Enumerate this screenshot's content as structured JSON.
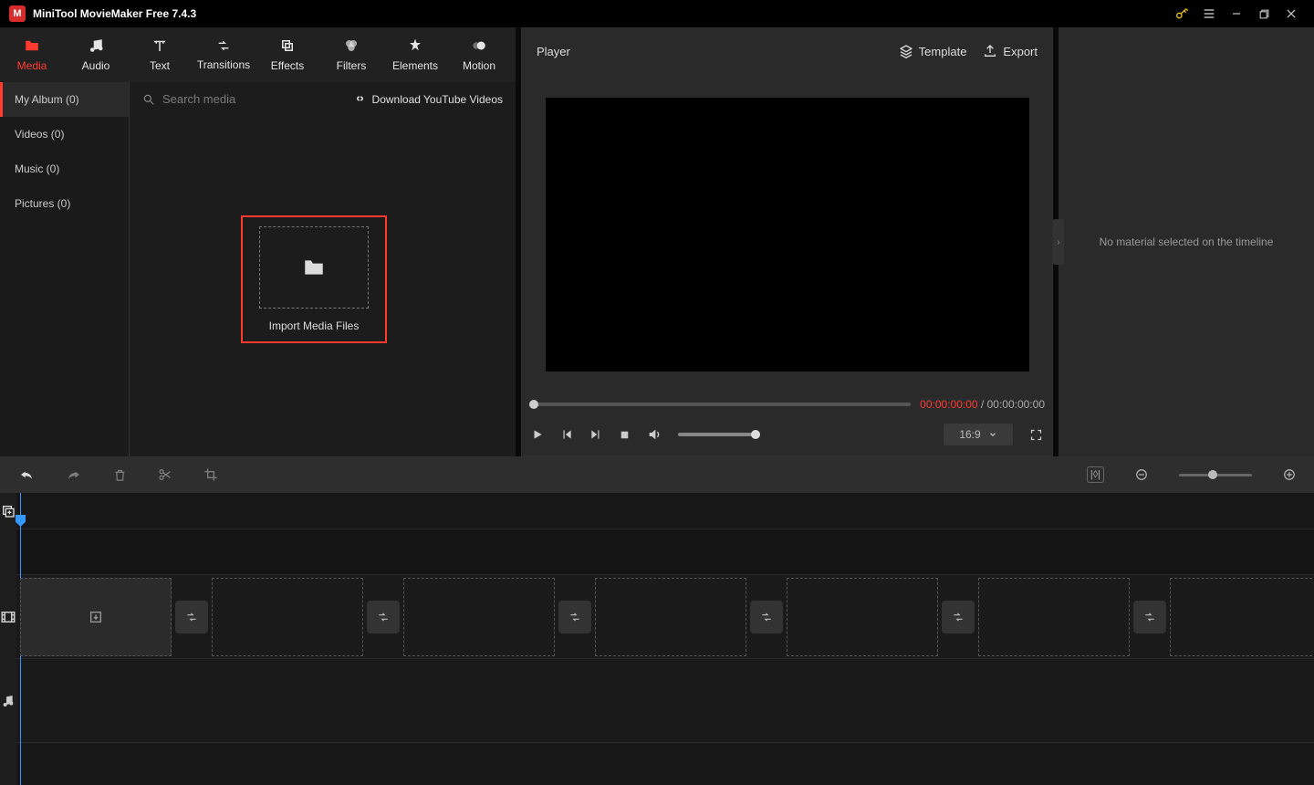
{
  "titlebar": {
    "title": "MiniTool MovieMaker Free 7.4.3"
  },
  "tabs": [
    {
      "label": "Media"
    },
    {
      "label": "Audio"
    },
    {
      "label": "Text"
    },
    {
      "label": "Transitions"
    },
    {
      "label": "Effects"
    },
    {
      "label": "Filters"
    },
    {
      "label": "Elements"
    },
    {
      "label": "Motion"
    }
  ],
  "sidebar": {
    "items": [
      {
        "label": "My Album (0)"
      },
      {
        "label": "Videos (0)"
      },
      {
        "label": "Music (0)"
      },
      {
        "label": "Pictures (0)"
      }
    ]
  },
  "search": {
    "placeholder": "Search media"
  },
  "download_link": "Download YouTube Videos",
  "import": {
    "label": "Import Media Files"
  },
  "player": {
    "title": "Player",
    "template_label": "Template",
    "export_label": "Export",
    "current_time": "00:00:00:00",
    "separator": " / ",
    "total_time": "00:00:00:00",
    "aspect": "16:9"
  },
  "inspector": {
    "message": "No material selected on the timeline"
  }
}
